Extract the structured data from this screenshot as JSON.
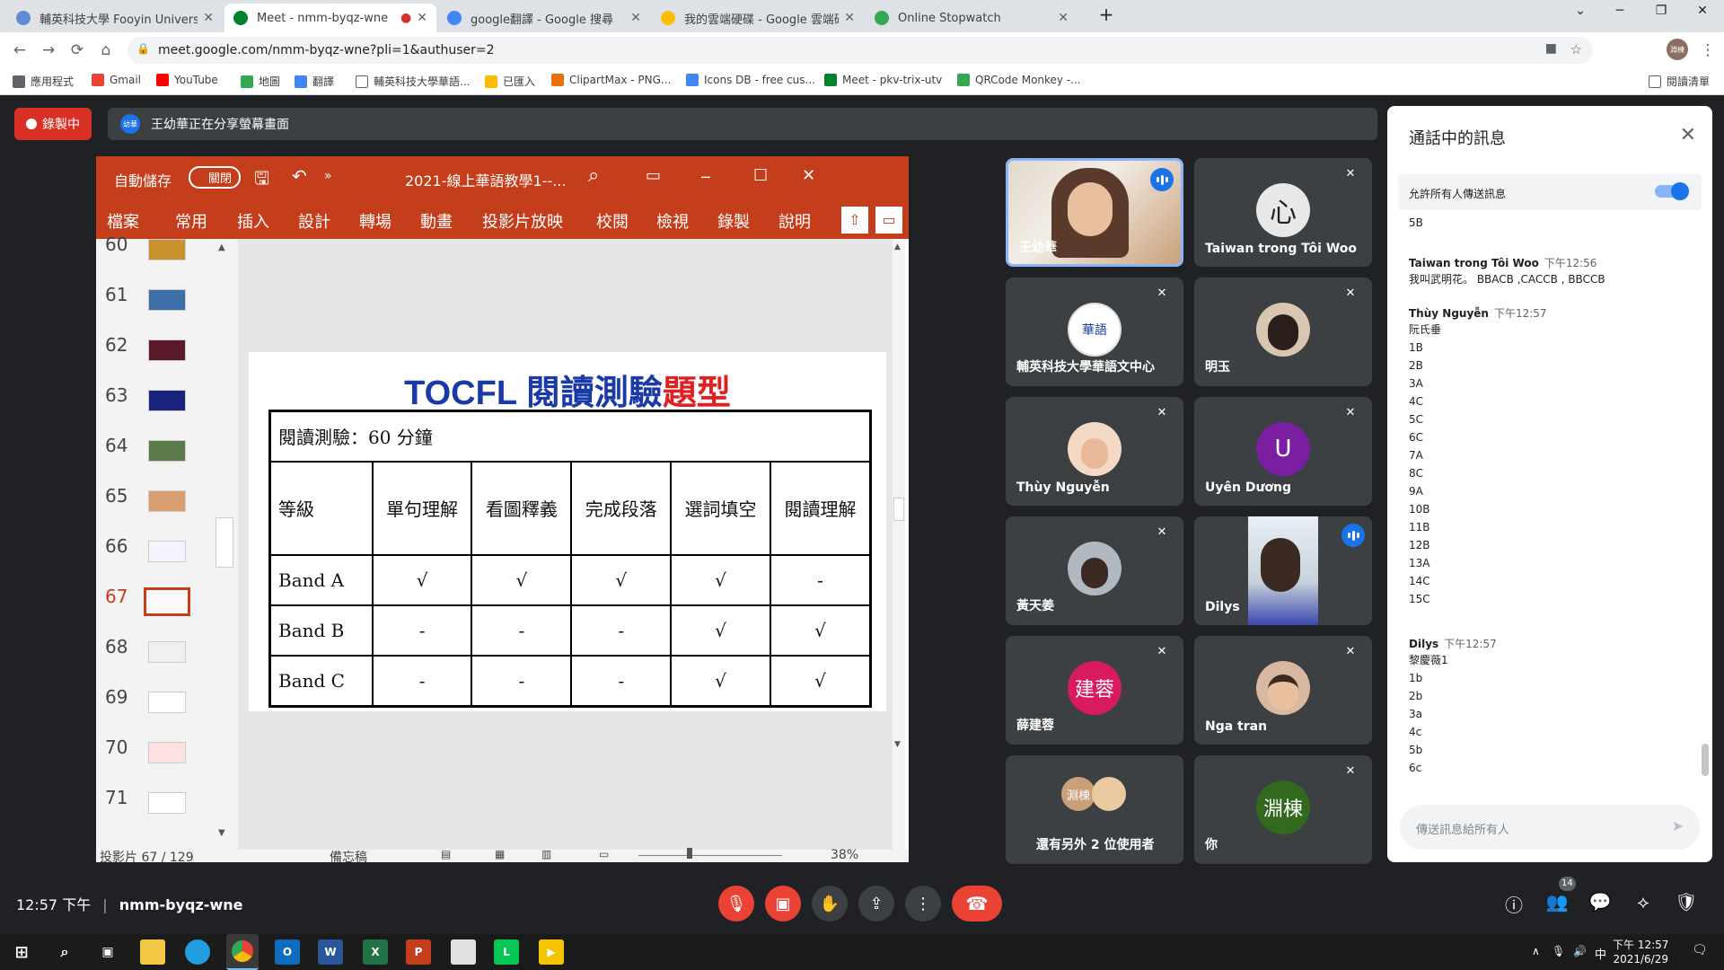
{
  "browser": {
    "tabs": [
      {
        "title": "輔英科技大學 Fooyin University",
        "color": "#5e8ad6"
      },
      {
        "title": "Meet - nmm-byqz-wne",
        "color": "#00832d"
      },
      {
        "title": "google翻譯 - Google 搜尋",
        "color": "#4285f4"
      },
      {
        "title": "我的雲端硬碟 - Google 雲端硬碟",
        "color": "#fbbc04"
      },
      {
        "title": "Online Stopwatch",
        "color": "#34a853"
      }
    ],
    "url": "meet.google.com/nmm-byqz-wne?pli=1&authuser=2",
    "bookmarks": [
      {
        "label": "應用程式",
        "color": "#5f6368"
      },
      {
        "label": "Gmail",
        "color": "#ea4335"
      },
      {
        "label": "YouTube",
        "color": "#ff0000"
      },
      {
        "label": "地圖",
        "color": "#34a853"
      },
      {
        "label": "翻譯",
        "color": "#4285f4"
      },
      {
        "label": "輔英科技大學華語...",
        "color": "#5f6368"
      },
      {
        "label": "已匯入",
        "color": "#fbbc04"
      },
      {
        "label": "ClipartMax - PNG...",
        "color": "#e8710a"
      },
      {
        "label": "Icons DB - free cus...",
        "color": "#4285f4"
      },
      {
        "label": "Meet - pkv-trix-utv",
        "color": "#00832d"
      },
      {
        "label": "QRCode Monkey -...",
        "color": "#34a853"
      }
    ],
    "reading_list": "閱讀清單",
    "profile": "淵棟"
  },
  "meet": {
    "recording_label": "錄製中",
    "presenter_avatar": "幼華",
    "presenting_text": "王幼華正在分享螢幕畫面",
    "clock": "12:57 下午",
    "meeting_code": "nmm-byqz-wne",
    "participant_count": "14"
  },
  "powerpoint": {
    "autosave": "自動儲存",
    "autosave_state": "關閉",
    "filename": "2021-線上華語教學1--...",
    "menu": [
      "檔案",
      "常用",
      "插入",
      "設計",
      "轉場",
      "動畫",
      "投影片放映",
      "校閱",
      "檢視",
      "錄製",
      "說明"
    ],
    "slide_numbers": [
      "60",
      "61",
      "62",
      "63",
      "64",
      "65",
      "66",
      "67",
      "68",
      "69",
      "70",
      "71"
    ],
    "status_slide": "投影片 67 / 129",
    "status_notes": "備忘稿",
    "zoom": "38%",
    "slide": {
      "title_blue": "TOCFL 閱讀測驗",
      "title_red": "題型",
      "table_caption": "閱讀測驗：60 分鐘",
      "headers": [
        "等級",
        "單句理解",
        "看圖釋義",
        "完成段落",
        "選詞填空",
        "閱讀理解"
      ],
      "rows": [
        [
          "Band A",
          "√",
          "√",
          "√",
          "√",
          "-"
        ],
        [
          "Band B",
          "-",
          "-",
          "-",
          "√",
          "√"
        ],
        [
          "Band C",
          "-",
          "-",
          "-",
          "√",
          "√"
        ]
      ]
    }
  },
  "participants": [
    {
      "name": "王幼華",
      "avatar": "",
      "color": "#c9a07a"
    },
    {
      "name": "Taiwan trong Tôi Woo",
      "avatar": "心",
      "color": "#e8e8e8"
    },
    {
      "name": "輔英科技大學華語文中心",
      "avatar": "華語",
      "color": "#ffffff"
    },
    {
      "name": "明玉",
      "avatar": "",
      "color": "#d9c6b0"
    },
    {
      "name": "Thùy Nguyễn",
      "avatar": "",
      "color": "#e8c9b0"
    },
    {
      "name": "Uyên Dương",
      "avatar": "U",
      "color": "#7b1fa2"
    },
    {
      "name": "黃天姜",
      "avatar": "",
      "color": "#b0b8c0"
    },
    {
      "name": "Dilys",
      "avatar": "",
      "color": "#dfe6ee"
    },
    {
      "name": "薛建蓉",
      "avatar": "建蓉",
      "color": "#d81b60"
    },
    {
      "name": "Nga tran",
      "avatar": "",
      "color": "#d8b8a0"
    },
    {
      "name": "還有另外 2 位使用者",
      "avatar": "淵棟",
      "color": "#c9a07a"
    },
    {
      "name": "你",
      "avatar": "淵棟",
      "color": "#33691e"
    }
  ],
  "chat": {
    "title": "通話中的訊息",
    "allow_label": "允許所有人傳送訊息",
    "top_line": "5B",
    "messages": [
      {
        "sender": "Taiwan trong Tôi Woo",
        "time": "下午12:56",
        "lines": [
          "我叫武明花。 BBACB ,CACCB , BBCCB"
        ]
      },
      {
        "sender": "Thùy Nguyễn",
        "time": "下午12:57",
        "lines": [
          "阮氏垂",
          "1B",
          "2B",
          "3A",
          "4C",
          "5C",
          "6C",
          "7A",
          "8C",
          "9A",
          "10B",
          "11B",
          "12B",
          "13A",
          "14C",
          "15C"
        ]
      },
      {
        "sender": "Dilys",
        "time": "下午12:57",
        "lines": [
          "黎慶薇1",
          "1b",
          "2b",
          "3a",
          "4c",
          "5b",
          "6c"
        ]
      }
    ],
    "input_placeholder": "傳送訊息給所有人"
  },
  "taskbar": {
    "time": "下午 12:57",
    "date": "2021/6/29",
    "ime": "中"
  }
}
